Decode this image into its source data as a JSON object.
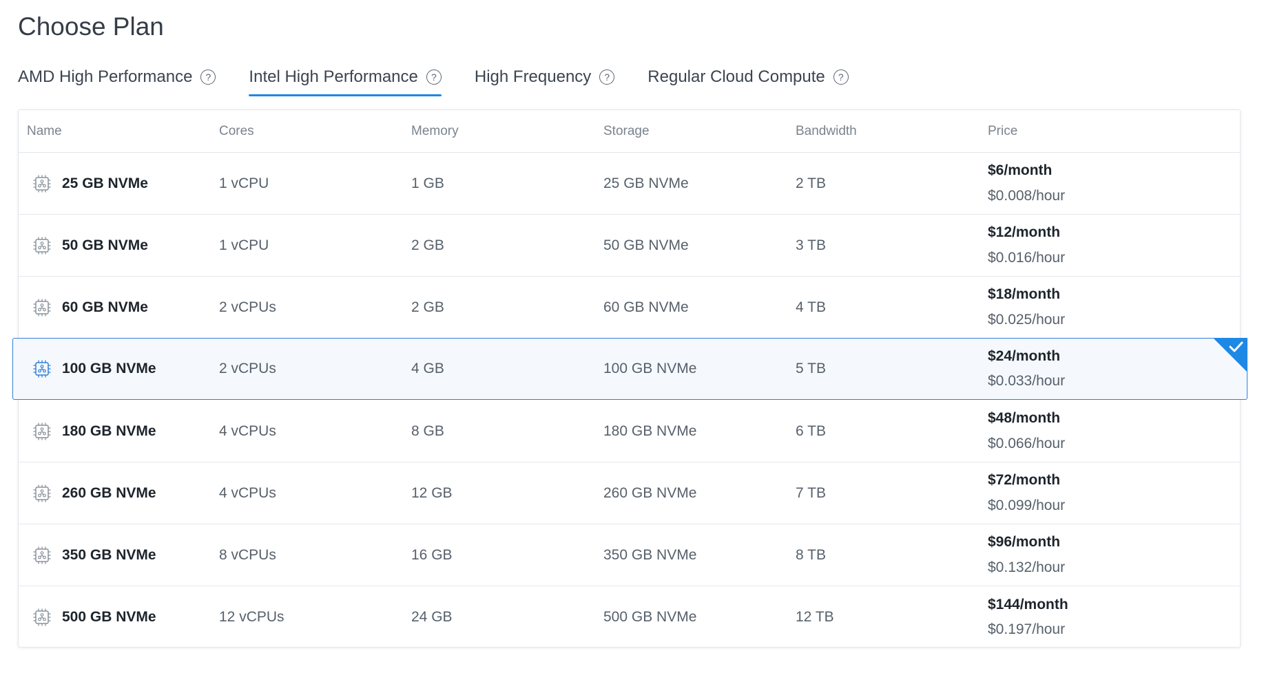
{
  "page": {
    "title": "Choose Plan"
  },
  "tabs": [
    {
      "label": "AMD High Performance",
      "active": false,
      "help_icon": "question-circle-icon"
    },
    {
      "label": "Intel High Performance",
      "active": true,
      "help_icon": "question-circle-icon"
    },
    {
      "label": "High Frequency",
      "active": false,
      "help_icon": "question-circle-icon"
    },
    {
      "label": "Regular Cloud Compute",
      "active": false,
      "help_icon": "question-circle-icon"
    }
  ],
  "table": {
    "headers": {
      "name": "Name",
      "cores": "Cores",
      "memory": "Memory",
      "storage": "Storage",
      "bandwidth": "Bandwidth",
      "price": "Price"
    },
    "rows": [
      {
        "name": "25 GB NVMe",
        "cores": "1 vCPU",
        "memory": "1 GB",
        "storage": "25 GB NVMe",
        "bandwidth": "2 TB",
        "monthly": "$6/month",
        "hourly": "$0.008/hour",
        "selected": false
      },
      {
        "name": "50 GB NVMe",
        "cores": "1 vCPU",
        "memory": "2 GB",
        "storage": "50 GB NVMe",
        "bandwidth": "3 TB",
        "monthly": "$12/month",
        "hourly": "$0.016/hour",
        "selected": false
      },
      {
        "name": "60 GB NVMe",
        "cores": "2 vCPUs",
        "memory": "2 GB",
        "storage": "60 GB NVMe",
        "bandwidth": "4 TB",
        "monthly": "$18/month",
        "hourly": "$0.025/hour",
        "selected": false
      },
      {
        "name": "100 GB NVMe",
        "cores": "2 vCPUs",
        "memory": "4 GB",
        "storage": "100 GB NVMe",
        "bandwidth": "5 TB",
        "monthly": "$24/month",
        "hourly": "$0.033/hour",
        "selected": true
      },
      {
        "name": "180 GB NVMe",
        "cores": "4 vCPUs",
        "memory": "8 GB",
        "storage": "180 GB NVMe",
        "bandwidth": "6 TB",
        "monthly": "$48/month",
        "hourly": "$0.066/hour",
        "selected": false
      },
      {
        "name": "260 GB NVMe",
        "cores": "4 vCPUs",
        "memory": "12 GB",
        "storage": "260 GB NVMe",
        "bandwidth": "7 TB",
        "monthly": "$72/month",
        "hourly": "$0.099/hour",
        "selected": false
      },
      {
        "name": "350 GB NVMe",
        "cores": "8 vCPUs",
        "memory": "16 GB",
        "storage": "350 GB NVMe",
        "bandwidth": "8 TB",
        "monthly": "$96/month",
        "hourly": "$0.132/hour",
        "selected": false
      },
      {
        "name": "500 GB NVMe",
        "cores": "12 vCPUs",
        "memory": "24 GB",
        "storage": "500 GB NVMe",
        "bandwidth": "12 TB",
        "monthly": "$144/month",
        "hourly": "$0.197/hour",
        "selected": false
      }
    ]
  },
  "icons": {
    "plan": "cpu-chip-icon",
    "selected_marker": "checkmark-icon"
  },
  "colors": {
    "accent": "#1e88e5",
    "selected_border": "#2f7fd6",
    "selected_bg": "#f5f9fe"
  }
}
